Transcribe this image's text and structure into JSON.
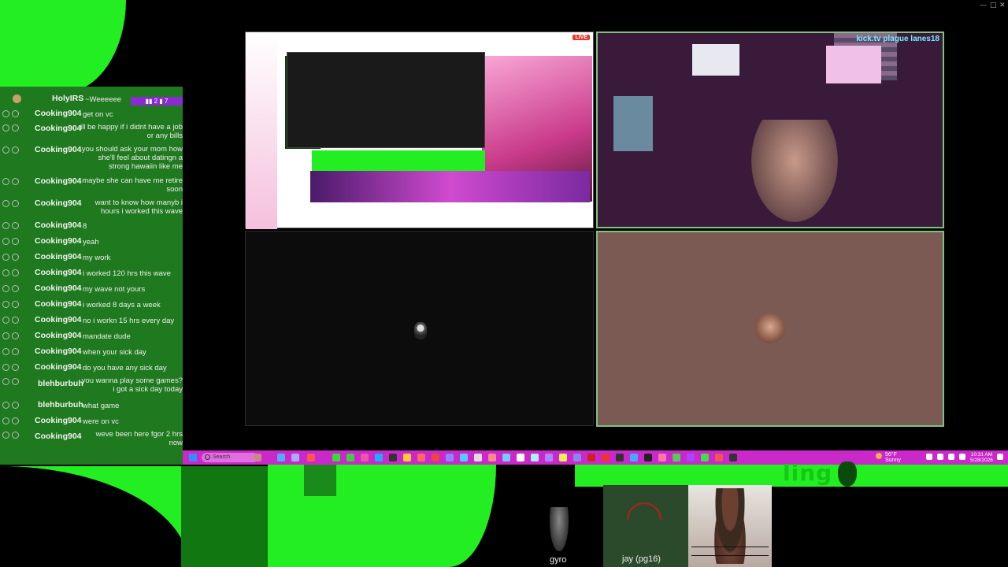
{
  "window": {
    "minimize": "—",
    "maximize": "□",
    "close": "✕"
  },
  "chat": {
    "messages": [
      {
        "user": "HolyIRS",
        "text": "~Weeeeee",
        "badges": "▮▮ 2 ▮ 7"
      },
      {
        "user": "Cooking904",
        "text": "get on vc"
      },
      {
        "user": "Cooking904",
        "text": "ill be happy if i didnt have a job or any bills"
      },
      {
        "user": "Cooking904",
        "text": "you should ask your mom how she'll feel about datingn a strong hawaiin like me"
      },
      {
        "user": "Cooking904",
        "text": "maybe she can have me retire soon"
      },
      {
        "user": "Cooking904",
        "text": "want to know how manyb i hours i worked this wave"
      },
      {
        "user": "Cooking904",
        "text": "8"
      },
      {
        "user": "Cooking904",
        "text": "yeah"
      },
      {
        "user": "Cooking904",
        "text": "my work"
      },
      {
        "user": "Cooking904",
        "text": "i worked 120 hrs this wave"
      },
      {
        "user": "Cooking904",
        "text": "my wave not yours"
      },
      {
        "user": "Cooking904",
        "text": "i worked 8 days a week"
      },
      {
        "user": "Cooking904",
        "text": "no i workn 15 hrs every day"
      },
      {
        "user": "Cooking904",
        "text": "mandate dude"
      },
      {
        "user": "Cooking904",
        "text": "when your sick day"
      },
      {
        "user": "Cooking904",
        "text": "do you have any sick day"
      },
      {
        "user": "blehburbuh",
        "text": "you wanna play some games? i got a sick day today"
      },
      {
        "user": "blehburbuh",
        "text": "what game"
      },
      {
        "user": "Cooking904",
        "text": "were on vc"
      },
      {
        "user": "Cooking904",
        "text": "weve been here fgor 2 hrs now"
      }
    ]
  },
  "call": {
    "screen_share": {
      "live_badge": "LIVE"
    },
    "cam": {
      "banner": "kick.tv plague lanes18"
    },
    "participants": [
      {
        "name": "gyro"
      },
      {
        "name": "jay (pg16)"
      }
    ]
  },
  "taskbar": {
    "search_placeholder": "Search",
    "weather": "56°F",
    "weather_sub": "Sunny",
    "time": "10:31 AM",
    "date": "5/28/2026"
  },
  "overlay": {
    "ling_text": "ling"
  },
  "colors": {
    "green_screen": "#22ee22",
    "taskbar": "#c929c9",
    "tile_border": "#7ec27e",
    "brown_tile": "#7a5a52"
  }
}
